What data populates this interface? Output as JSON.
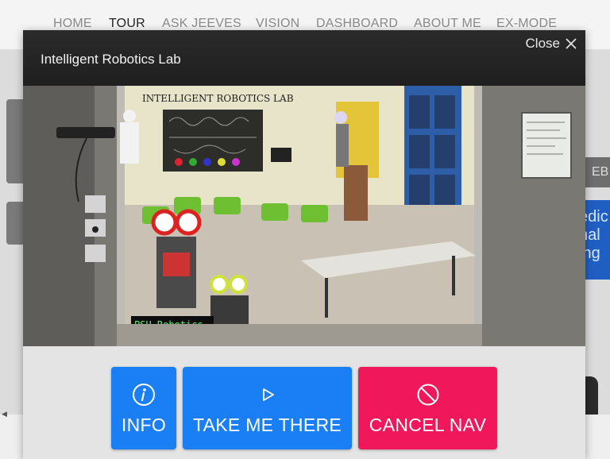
{
  "nav": {
    "items": [
      {
        "label": "HOME",
        "active": false
      },
      {
        "label": "TOUR",
        "active": true
      },
      {
        "label": "ASK JEEVES",
        "active": false
      },
      {
        "label": "VISION",
        "active": false
      },
      {
        "label": "DASHBOARD",
        "active": false
      },
      {
        "label": "ABOUT ME",
        "active": false
      },
      {
        "label": "EX-MODE",
        "active": false
      }
    ]
  },
  "background": {
    "right_box_text": "EB",
    "right_blue_lines": [
      "edic",
      "nal",
      "ing"
    ]
  },
  "modal": {
    "title": "Intelligent Robotics Lab",
    "close_label": "Close",
    "photo": {
      "wall_sign": "INTELLIGENT ROBOTICS LAB",
      "led_sign": "PSU Robotics"
    },
    "actions": {
      "info_label": "INFO",
      "go_label": "TAKE ME THERE",
      "cancel_label": "CANCEL NAV"
    }
  },
  "colors": {
    "primary_button": "#1a7ff5",
    "cancel_button": "#f0185a",
    "modal_header": "#1f1f1f",
    "nav_active": "#222222",
    "nav_inactive": "#8a8a8a"
  }
}
